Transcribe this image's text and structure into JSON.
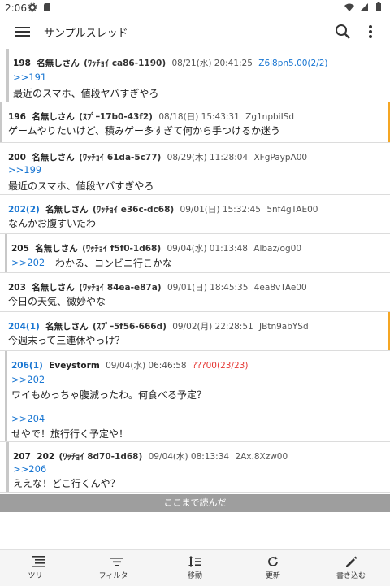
{
  "status": {
    "time": "2:06"
  },
  "appbar": {
    "title": "サンプルスレッド"
  },
  "posts": [
    {
      "num": "198",
      "name": "名無しさん",
      "uid": "(ﾜｯﾁｮｲ ca86-1190)",
      "date": "08/21(水) 20:41:25",
      "id": "Z6j8pn5.00(2/2)",
      "anchor": ">>191",
      "body": "最近のスマホ、値段ヤバすぎやろ"
    },
    {
      "num": "196",
      "name": "名無しさん",
      "uid": "(ｽﾌﾟｰ17b0-43f2)",
      "date": "08/18(日) 15:43:31",
      "id": "Zg1npbiISd",
      "body": "ゲームやりたいけど、積みゲー多すぎて何から手つけるか迷う"
    },
    {
      "num": "200",
      "name": "名無しさん",
      "uid": "(ﾜｯﾁｮｲ 61da-5c77)",
      "date": "08/29(木) 11:28:04",
      "id": "XFgPaypA00",
      "anchor": ">>199",
      "body": "最近のスマホ、値段ヤバすぎやろ"
    },
    {
      "num": "202(2)",
      "name": "名無しさん",
      "uid": "(ﾜｯﾁｮｲ e36c-dc68)",
      "date": "09/01(日) 15:32:45",
      "id": "5nf4gTAE00",
      "body": "なんかお腹すいたわ"
    },
    {
      "num": "205",
      "name": "名無しさん",
      "uid": "(ﾜｯﾁｮｲ f5f0-1d68)",
      "date": "09/04(水) 01:13:48",
      "id": "Albaz/og00",
      "anchor": ">>202",
      "body": "わかる、コンビニ行こかな"
    },
    {
      "num": "203",
      "name": "名無しさん",
      "uid": "(ﾜｯﾁｮｲ 84ea-e87a)",
      "date": "09/01(日) 18:45:35",
      "id": "4ea8vTAe00",
      "body": "今日の天気、微妙やな"
    },
    {
      "num": "204(1)",
      "name": "名無しさん",
      "uid": "(ｽﾌﾟｰ5f56-666d)",
      "date": "09/02(月) 22:28:51",
      "id": "JBtn9abYSd",
      "body": "今週末って三連休やっけ？"
    },
    {
      "num": "206(1)",
      "name": "Eveystorm",
      "date": "09/04(水) 06:46:58",
      "id": "???00(23/23)",
      "anchor": ">>202",
      "body": "ワイもめっちゃ腹減ったわ。何食べる予定？",
      "anchor2": ">>204",
      "body2": "せやで！旅行行く予定や！"
    },
    {
      "num": "207",
      "name": "202",
      "uid": "(ﾜｯﾁｮｲ 8d70-1d68)",
      "date": "09/04(水) 08:13:34",
      "id": "2Ax.8Xzw00",
      "anchor": ">>206",
      "body": "ええな！どこ行くんや？"
    }
  ],
  "readbar": {
    "label": "ここまで読んだ"
  },
  "bottomnav": [
    {
      "label": "ツリー",
      "icon": "tree-icon"
    },
    {
      "label": "フィルター",
      "icon": "filter-icon"
    },
    {
      "label": "移動",
      "icon": "move-icon"
    },
    {
      "label": "更新",
      "icon": "refresh-icon"
    },
    {
      "label": "書き込む",
      "icon": "pencil-icon"
    }
  ],
  "colors": {
    "link": "#1976d2",
    "accent_bar": "#f5a623",
    "red_id": "#e53935",
    "read_bar": "#9e9e9e"
  }
}
